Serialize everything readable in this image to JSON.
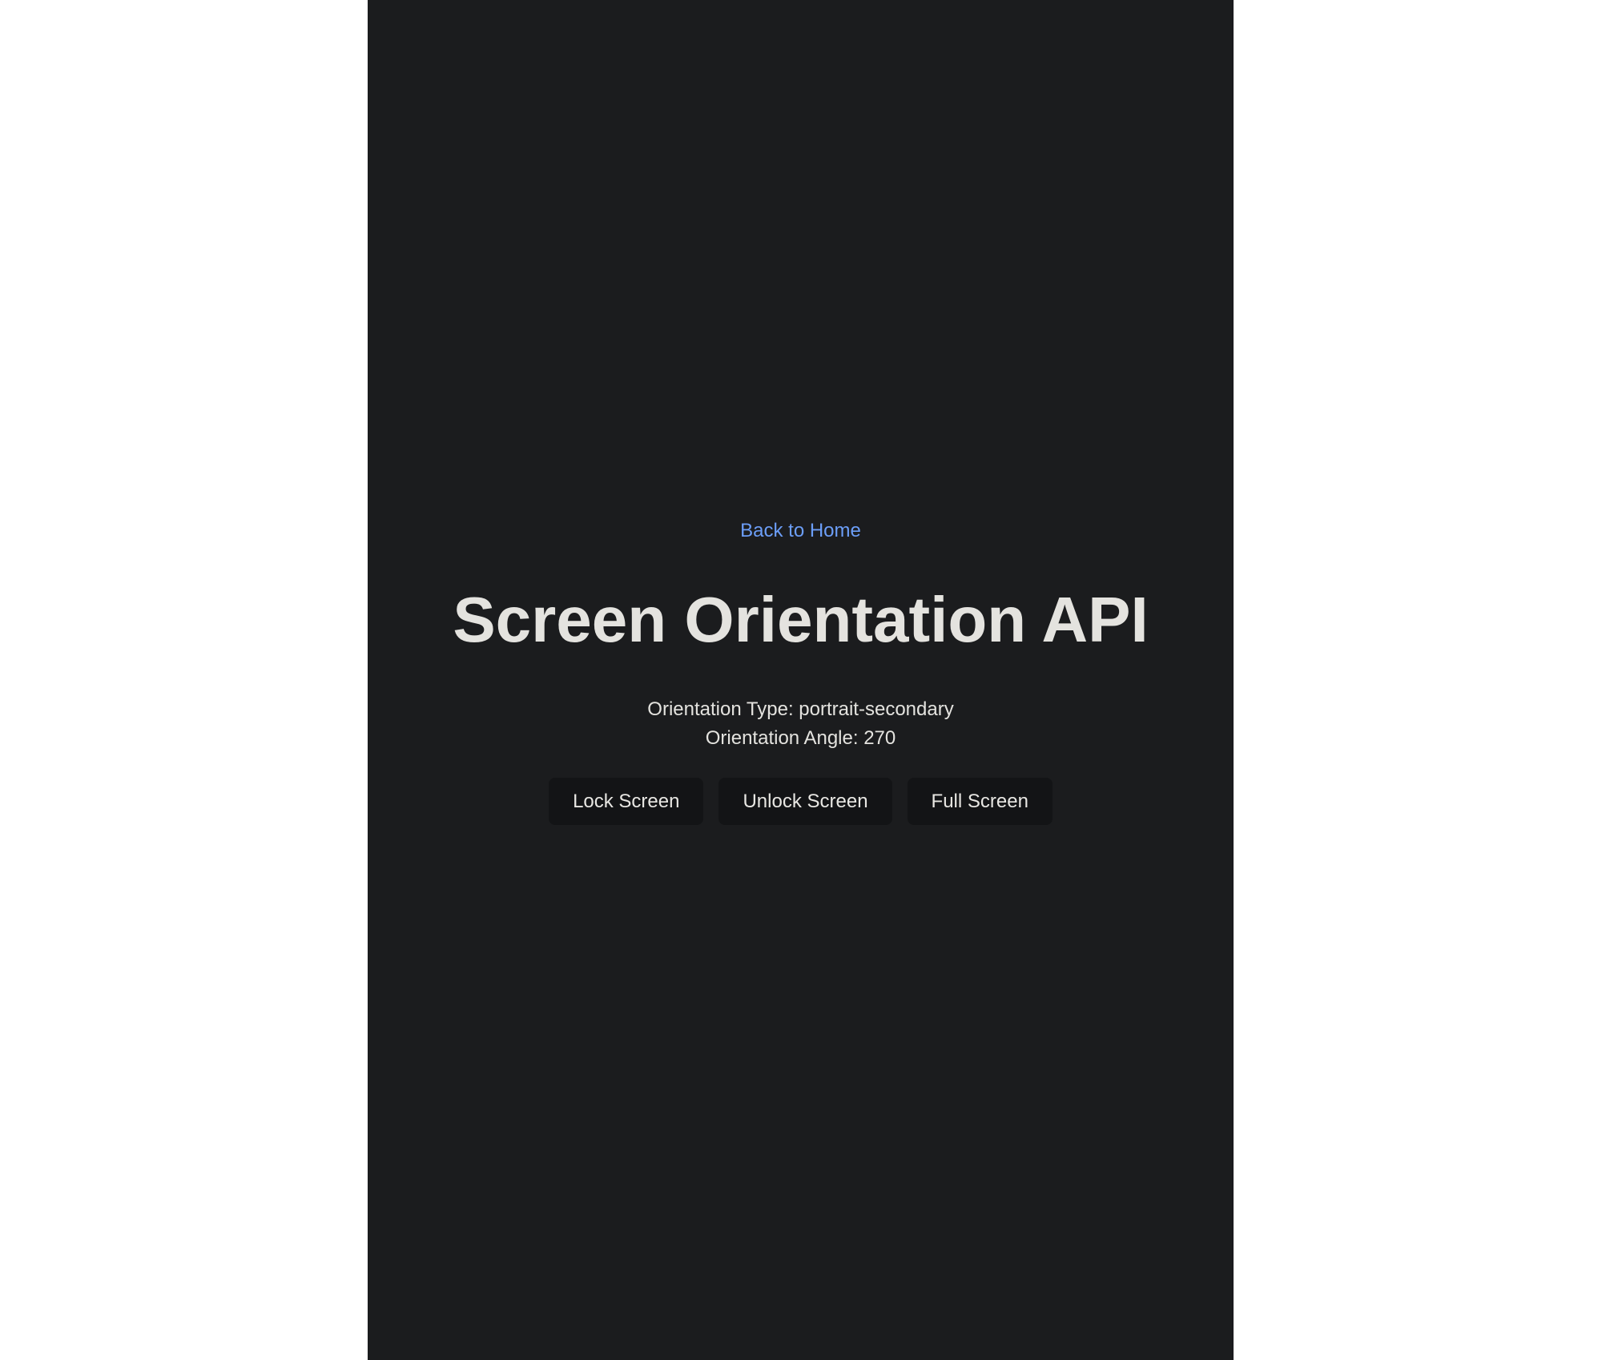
{
  "nav": {
    "back_label": "Back to Home"
  },
  "header": {
    "title": "Screen Orientation API"
  },
  "orientation": {
    "type_label": "Orientation Type: ",
    "type_value": "portrait-secondary",
    "angle_label": "Orientation Angle: ",
    "angle_value": "270"
  },
  "controls": {
    "lock_label": "Lock Screen",
    "unlock_label": "Unlock Screen",
    "fullscreen_label": "Full Screen"
  },
  "colors": {
    "background": "#1b1c1e",
    "link": "#6c9ef8",
    "text": "#e4e3df",
    "button_bg": "#131416"
  }
}
